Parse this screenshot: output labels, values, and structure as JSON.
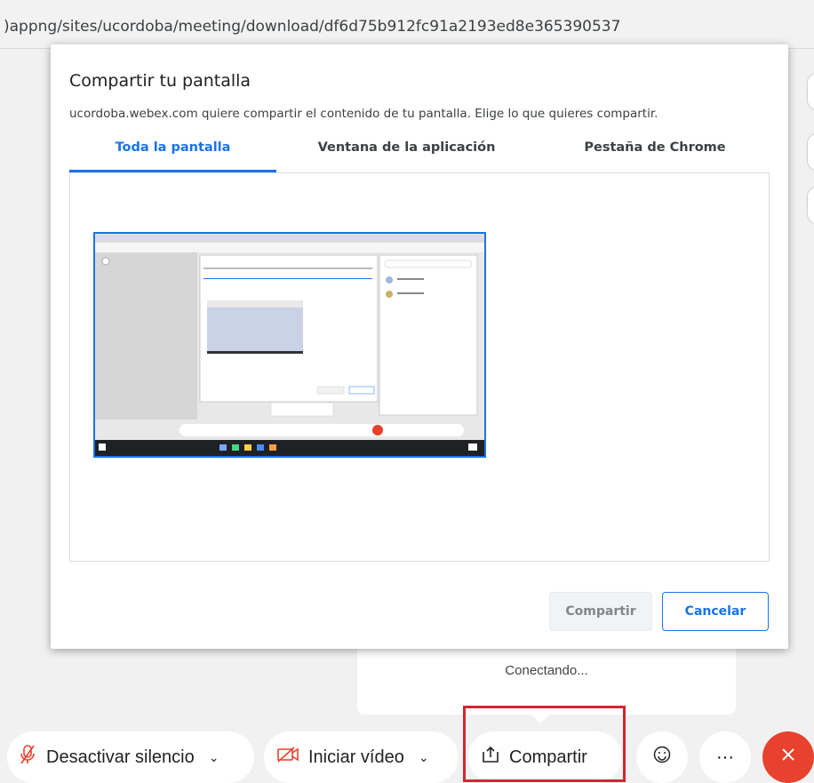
{
  "browser": {
    "url": ")appng/sites/ucordoba/meeting/download/df6d75b912fc91a2193ed8e365390537"
  },
  "dialog": {
    "title": "Compartir tu pantalla",
    "subtitle": "ucordoba.webex.com quiere compartir el contenido de tu pantalla. Elige lo que quieres compartir.",
    "tabs": [
      {
        "label": "Toda la pantalla",
        "active": true
      },
      {
        "label": "Ventana de la aplicación",
        "active": false
      },
      {
        "label": "Pestaña de Chrome",
        "active": false
      }
    ],
    "share_label": "Compartir",
    "cancel_label": "Cancelar"
  },
  "meeting": {
    "connecting_text": "Conectando...",
    "toolbar": {
      "mute_label": "Desactivar silencio",
      "video_label": "Iniciar vídeo",
      "share_label": "Compartir"
    }
  },
  "colors": {
    "accent": "#1a73e8",
    "highlight": "#d9232e",
    "end_call": "#e8412d",
    "mic_off": "#e8412d"
  },
  "icons": [
    "mic-off-icon",
    "chevron-down-icon",
    "video-off-icon",
    "share-icon",
    "emoji-icon",
    "more-icon",
    "close-icon"
  ]
}
